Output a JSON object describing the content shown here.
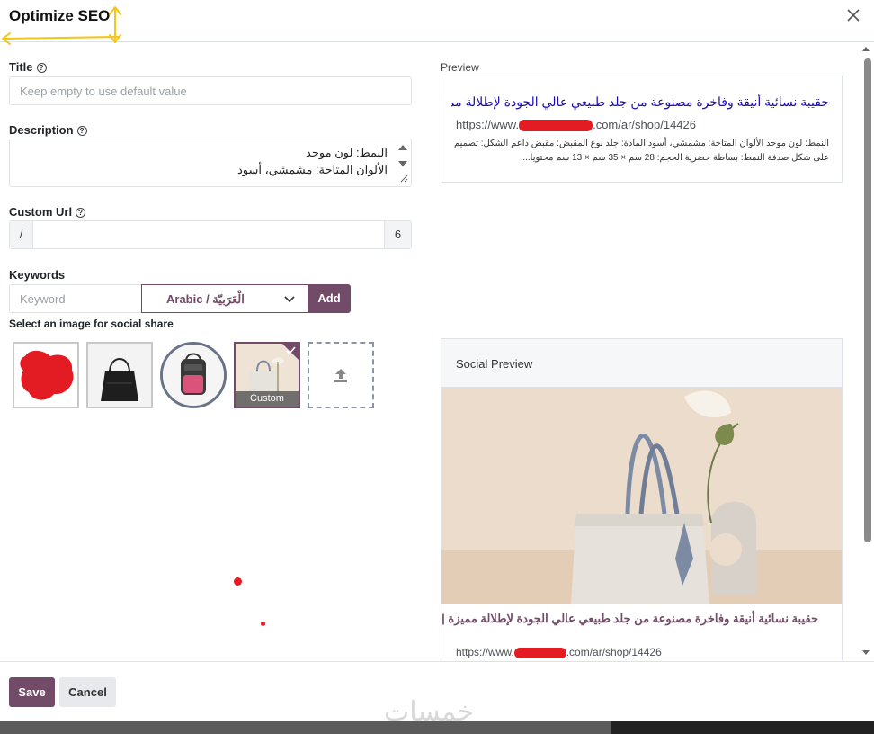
{
  "dialog": {
    "title": "Optimize SEO",
    "close_icon": "close-icon"
  },
  "form": {
    "title_label": "Title",
    "title_placeholder": "Keep empty to use default value",
    "description_label": "Description",
    "description_line1": "النمط: لون موحد",
    "description_line2": "الألوان المتاحة: مشمشي، أسود",
    "custom_url_label": "Custom Url",
    "url_prefix": "/",
    "url_count": "6",
    "keywords_label": "Keywords",
    "keyword_placeholder": "Keyword",
    "language_selected": "Arabic / الْعَرَبيّة",
    "add_label": "Add",
    "image_section_label": "Select an image for social share",
    "custom_badge": "Custom"
  },
  "preview": {
    "label": "Preview",
    "title": "حقيبة نسائية أنيقة وفاخرة مصنوعة من جلد طبيعي عالي الجودة لإطلالة مميزة...",
    "url_start": "https://www.",
    "url_end": ".com/ar/shop/14426",
    "description": "النمط: لون موحد الألوان المتاحة: مشمشي، أسود المادة: جلد نوع المقبض: مقبض داعم الشكل: تصميم على شكل صدفة النمط: بساطة حضرية الحجم: 28 سم × 35 سم × 13 سم محتويا..."
  },
  "social": {
    "label": "Social Preview",
    "title": "حقيبة نسائية أنيقة وفاخرة مصنوعة من جلد طبيعي عالي الجودة لإطلالة مميزة |",
    "url_start": "https://www.",
    "url_end": ".com/ar/shop/14426"
  },
  "footer": {
    "save_label": "Save",
    "cancel_label": "Cancel",
    "watermark": "خمسات"
  },
  "colors": {
    "primary": "#714b67",
    "link": "#1a0dab",
    "redaction": "#e31b23"
  }
}
